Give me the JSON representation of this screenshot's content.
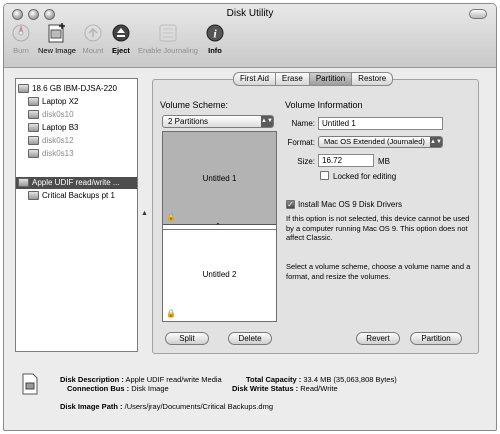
{
  "window": {
    "title": "Disk Utility"
  },
  "toolbar": {
    "items": [
      {
        "label": "Burn",
        "icon": "burn-icon",
        "enabled": false
      },
      {
        "label": "New Image",
        "icon": "new-image-icon",
        "enabled": true
      },
      {
        "label": "Mount",
        "icon": "mount-icon",
        "enabled": false
      },
      {
        "label": "Eject",
        "icon": "eject-icon",
        "enabled": true
      },
      {
        "label": "Enable Journaling",
        "icon": "journaling-icon",
        "enabled": false
      },
      {
        "label": "Info",
        "icon": "info-icon",
        "enabled": true
      }
    ]
  },
  "sidebar": {
    "items": [
      {
        "label": "18.6 GB IBM-DJSA-220",
        "state": "normal"
      },
      {
        "label": "Laptop X2",
        "state": "normal"
      },
      {
        "label": "disk0s10",
        "state": "gray"
      },
      {
        "label": "Laptop B3",
        "state": "normal"
      },
      {
        "label": "disk0s12",
        "state": "gray"
      },
      {
        "label": "disk0s13",
        "state": "gray"
      },
      {
        "label": "Apple UDIF read/write ...",
        "state": "selected"
      },
      {
        "label": "Critical Backups pt 1",
        "state": "normal"
      }
    ]
  },
  "tabs": [
    {
      "label": "First Aid",
      "active": false
    },
    {
      "label": "Erase",
      "active": false
    },
    {
      "label": "Partition",
      "active": true
    },
    {
      "label": "Restore",
      "active": false
    }
  ],
  "partition": {
    "scheme_label": "Volume Scheme:",
    "scheme_value": "2 Partitions",
    "volumes": [
      "Untitled 1",
      "Untitled 2"
    ],
    "info_title": "Volume Information",
    "name_label": "Name:",
    "name_value": "Untitled 1",
    "format_label": "Format:",
    "format_value": "Mac OS Extended (Journaled)",
    "size_label": "Size:",
    "size_value": "16.72",
    "size_unit": "MB",
    "locked_label": "Locked for editing",
    "locked_checked": false,
    "os9_label": "Install Mac OS 9 Disk Drivers",
    "os9_checked": true,
    "os9_help": "If this option is not selected, this device cannot be used by a computer running Mac OS 9. This option does not affect Classic.",
    "instructions": "Select a volume scheme, choose a volume name and a format, and resize the volumes.",
    "buttons": {
      "split": "Split",
      "delete": "Delete",
      "revert": "Revert",
      "partition": "Partition"
    }
  },
  "info": {
    "disk_description_label": "Disk Description :",
    "disk_description_value": "Apple UDIF read/write Media",
    "connection_bus_label": "Connection Bus :",
    "connection_bus_value": "Disk Image",
    "total_capacity_label": "Total Capacity :",
    "total_capacity_value": "33.4 MB (35,063,808 Bytes)",
    "write_status_label": "Disk Write Status :",
    "write_status_value": "Read/Write",
    "image_path_label": "Disk Image Path :",
    "image_path_value": "/Users/jray/Documents/Critical Backups.dmg"
  }
}
